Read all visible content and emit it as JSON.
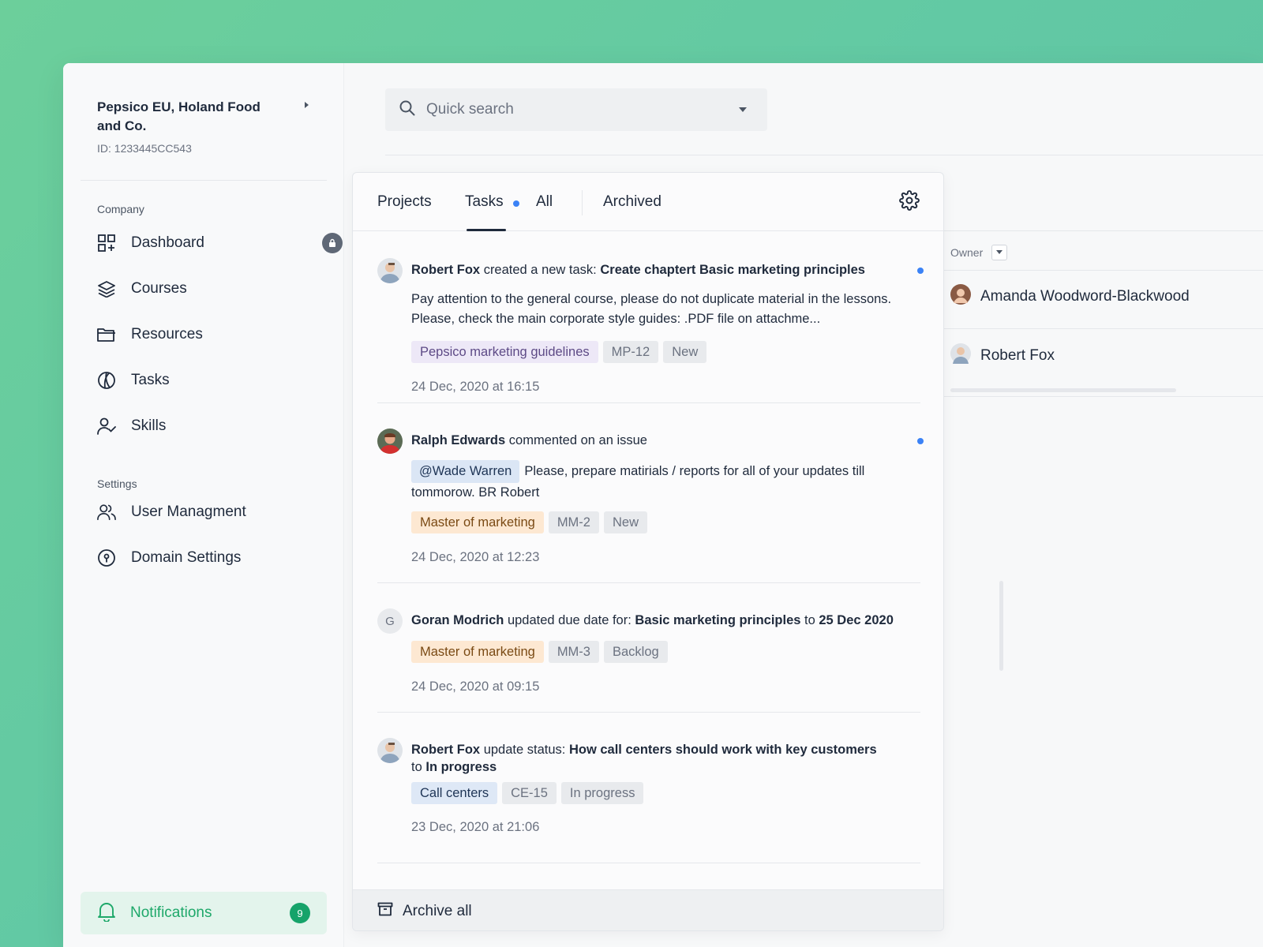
{
  "org": {
    "name": "Pepsico EU, Holand Food and Co.",
    "id_label": "ID: 1233445CC543"
  },
  "sidebar": {
    "company_label": "Company",
    "settings_label": "Settings",
    "items": [
      {
        "label": "Dashboard",
        "icon": "dashboard-icon",
        "locked": true
      },
      {
        "label": "Courses",
        "icon": "layers-icon"
      },
      {
        "label": "Resources",
        "icon": "folder-icon"
      },
      {
        "label": "Tasks",
        "icon": "tasks-icon"
      },
      {
        "label": "Skills",
        "icon": "user-check-icon"
      }
    ],
    "settings_items": [
      {
        "label": "User Managment",
        "icon": "users-icon"
      },
      {
        "label": "Domain Settings",
        "icon": "domain-icon"
      }
    ],
    "notifications": {
      "label": "Notifications",
      "count": "9"
    }
  },
  "search": {
    "placeholder": "Quick search"
  },
  "table": {
    "owner_header": "Owner",
    "owners": [
      "Amanda Woodword-Blackwood",
      "Robert Fox"
    ]
  },
  "panel": {
    "tabs": [
      "Projects",
      "Tasks",
      "All",
      "Archived"
    ],
    "active_tab": "Tasks",
    "items": [
      {
        "actor": "Robert Fox",
        "action": "created a new task:",
        "target": "Create chaptert Basic marketing principles",
        "body": "Pay attention to the general course, please do not duplicate material in the lessons. Please, check the main corporate style guides: .PDF file on attachme...",
        "tags": [
          "Pepsico marketing guidelines",
          "MP-12",
          "New"
        ],
        "time": "24 Dec, 2020 at 16:15",
        "unread": true
      },
      {
        "actor": "Ralph Edwards",
        "action": "commented on an issue",
        "mention": "@Wade Warren",
        "body": "Please, prepare matirials / reports for all of your updates till tommorow. BR Robert",
        "tags": [
          "Master of marketing",
          "MM-2",
          "New"
        ],
        "time": "24 Dec, 2020 at 12:23",
        "unread": true
      },
      {
        "avatar_letter": "G",
        "actor": "Goran Modrich",
        "action": "updated due date for:",
        "target": "Basic marketing principles",
        "connector": "to",
        "target2": "25 Dec 2020",
        "tags": [
          "Master of marketing",
          "MM-3",
          "Backlog"
        ],
        "time": "24 Dec, 2020 at 09:15"
      },
      {
        "actor": "Robert Fox",
        "action": "update status:",
        "target": "How call centers should work with key customers",
        "connector": "to",
        "target2": "In progress",
        "tags": [
          "Call centers",
          "CE-15",
          "In progress"
        ],
        "time": "23 Dec, 2020 at 21:06"
      }
    ],
    "archive_all": "Archive all"
  },
  "colors": {
    "accent_green": "#16a36a",
    "unread_blue": "#3b82f6",
    "text_dark": "#1f2a3c"
  }
}
